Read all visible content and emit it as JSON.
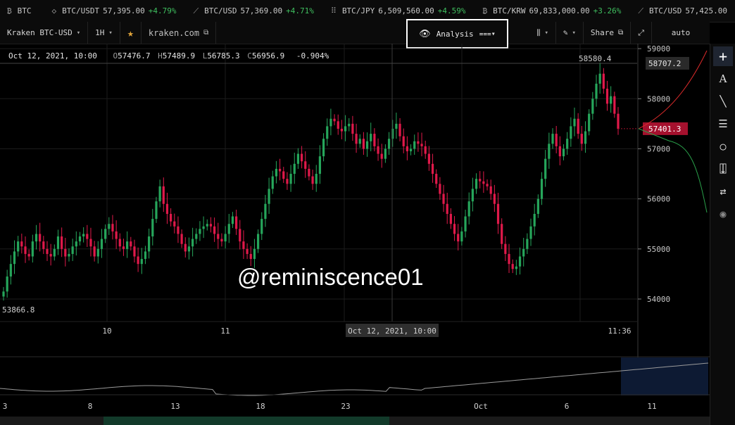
{
  "ticker": [
    {
      "icon": "bitcoin-icon",
      "glyph": "₿",
      "symbol": "BTC",
      "price": "",
      "change": ""
    },
    {
      "icon": "ethereum-icon",
      "glyph": "◇",
      "symbol": "BTC/USDT",
      "price": "57,395.00",
      "change": "+4.79%"
    },
    {
      "icon": "leaf-icon",
      "glyph": "⟋",
      "symbol": "BTC/USD",
      "price": "57,369.00",
      "change": "+4.71%"
    },
    {
      "icon": "hashgraph-icon",
      "glyph": "⠿",
      "symbol": "BTC/JPY",
      "price": "6,509,560.00",
      "change": "+4.59%"
    },
    {
      "icon": "bitcoin-icon",
      "glyph": "₿",
      "symbol": "BTC/KRW",
      "price": "69,833,000.00",
      "change": "+3.26%"
    },
    {
      "icon": "leaf-icon",
      "glyph": "⟋",
      "symbol": "BTC/USD",
      "price": "57,425.00",
      "change": ""
    }
  ],
  "toolbar": {
    "pair": "Kraken BTC-USD",
    "interval": "1H",
    "site": "kraken.com",
    "analysis": "Analysis",
    "share": "Share",
    "scale": "auto"
  },
  "ohlc": {
    "date": "Oct 12, 2021, 10:00",
    "o_label": "O",
    "o": "57476.7",
    "h_label": "H",
    "h": "57489.9",
    "l_label": "L",
    "l": "56785.3",
    "c_label": "C",
    "c": "56956.9",
    "change": "-0.904%"
  },
  "watermark": "@reminiscence01",
  "chart_data": {
    "type": "candlestick",
    "title": "Kraken BTC-USD",
    "interval": "1H",
    "y_ticks": [
      59000,
      58000,
      57000,
      56000,
      55000,
      54000
    ],
    "ylim": [
      53550,
      59100
    ],
    "x_ticks": [
      "10",
      "11",
      "Oct 12, 2021, 10:00",
      "11:36"
    ],
    "price_labels": {
      "high": "58707.2",
      "current": "57401.3",
      "visible_high": "58580.4",
      "visible_low": "53866.8"
    },
    "colors": {
      "up": "#26a65b",
      "down": "#e0194a",
      "current_label_bg": "#a5112e",
      "ask_line": "#d92a2a",
      "bid_line": "#2aa04a"
    },
    "closes": [
      54150,
      54450,
      54700,
      54950,
      55150,
      55050,
      54900,
      54850,
      55150,
      55300,
      55150,
      55000,
      54900,
      54850,
      55000,
      55250,
      55000,
      54850,
      54900,
      55050,
      55150,
      55250,
      55300,
      55200,
      55050,
      54850,
      55000,
      55200,
      55400,
      55500,
      55350,
      55200,
      55050,
      55000,
      55150,
      55050,
      54850,
      54700,
      54800,
      54950,
      55250,
      55600,
      55950,
      56250,
      55900,
      55700,
      55550,
      55450,
      55300,
      55100,
      54950,
      55050,
      55200,
      55300,
      55400,
      55450,
      55500,
      55450,
      55300,
      55200,
      55150,
      55300,
      55500,
      55650,
      55400,
      55150,
      55000,
      54900,
      54800,
      55000,
      55300,
      55600,
      55900,
      56200,
      56450,
      56600,
      56550,
      56400,
      56300,
      56500,
      56700,
      56900,
      56750,
      56600,
      56450,
      56300,
      56500,
      56850,
      57200,
      57450,
      57600,
      57550,
      57400,
      57350,
      57450,
      57500,
      57300,
      57100,
      57200,
      57000,
      57150,
      57300,
      57050,
      56900,
      56800,
      57000,
      57200,
      57400,
      57500,
      57250,
      57050,
      56950,
      57000,
      57150,
      57100,
      57050,
      56900,
      56700,
      56500,
      56300,
      56100,
      55900,
      55700,
      55500,
      55300,
      55150,
      55350,
      55650,
      55950,
      56200,
      56400,
      56350,
      56300,
      56250,
      56100,
      55900,
      55500,
      55100,
      54900,
      54700,
      54600,
      54650,
      54850,
      55000,
      55200,
      55450,
      55700,
      56000,
      56400,
      56800,
      57100,
      57300,
      57050,
      56850,
      57000,
      57200,
      57450,
      57600,
      57300,
      57100,
      57350,
      57700,
      58000,
      58300,
      58500,
      58200,
      57900,
      58050,
      57700,
      57400
    ]
  },
  "volume_axis": {
    "labels": [
      "3",
      "8",
      "13",
      "18",
      "23",
      "Oct",
      "6",
      "11"
    ]
  }
}
